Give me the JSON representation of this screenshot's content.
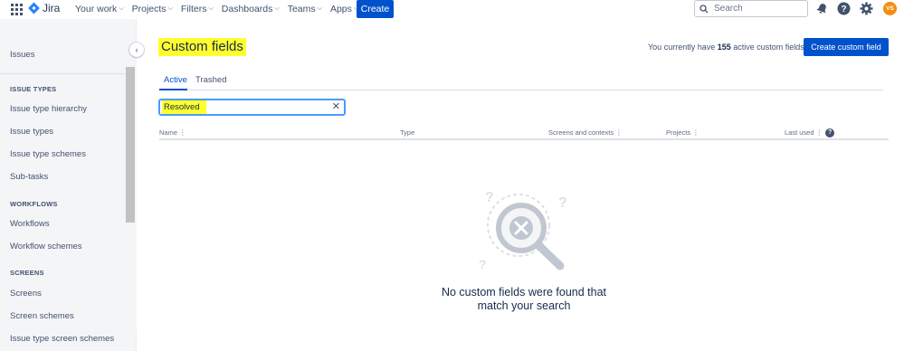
{
  "app": {
    "name": "Jira"
  },
  "nav": {
    "items": [
      {
        "label": "Your work"
      },
      {
        "label": "Projects"
      },
      {
        "label": "Filters"
      },
      {
        "label": "Dashboards"
      },
      {
        "label": "Teams"
      },
      {
        "label": "Apps"
      }
    ],
    "create_label": "Create",
    "search_placeholder": "Search",
    "avatar_initials": "VS"
  },
  "sidebar": {
    "title": "Issues",
    "sections": [
      {
        "heading": "ISSUE TYPES",
        "items": [
          "Issue type hierarchy",
          "Issue types",
          "Issue type schemes",
          "Sub-tasks"
        ]
      },
      {
        "heading": "WORKFLOWS",
        "items": [
          "Workflows",
          "Workflow schemes"
        ]
      },
      {
        "heading": "SCREENS",
        "items": [
          "Screens",
          "Screen schemes",
          "Issue type screen schemes"
        ]
      }
    ]
  },
  "main": {
    "title": "Custom fields",
    "count_prefix": "You currently have",
    "count": "155",
    "count_suffix": "active custom fields",
    "create_button": "Create custom field",
    "tabs": [
      {
        "label": "Active"
      },
      {
        "label": "Trashed"
      }
    ],
    "filter_value": "Resolved",
    "columns": [
      {
        "label": "Name"
      },
      {
        "label": "Type"
      },
      {
        "label": "Screens and contexts"
      },
      {
        "label": "Projects"
      },
      {
        "label": "Last used"
      }
    ],
    "empty_line1": "No custom fields were found that",
    "empty_line2": "match your search"
  },
  "colors": {
    "accent": "#0052cc",
    "highlight": "#ffff2e",
    "avatar": "#f18d13"
  }
}
